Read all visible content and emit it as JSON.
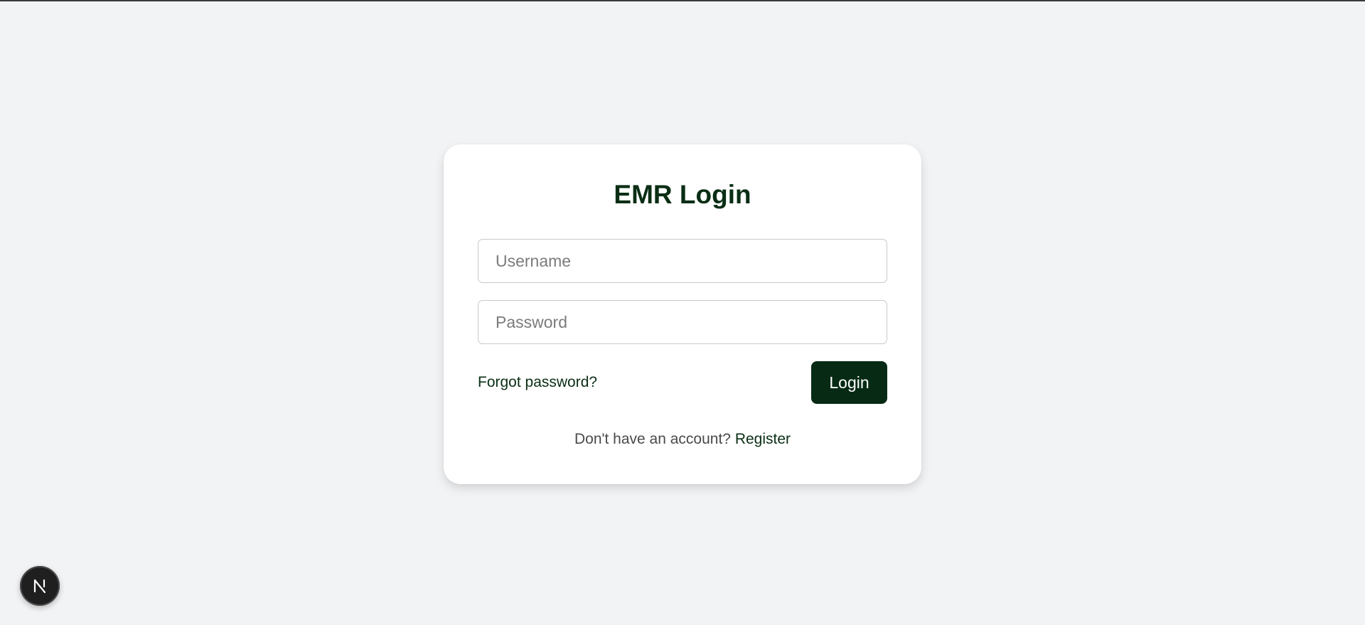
{
  "login_card": {
    "title": "EMR Login",
    "username_placeholder": "Username",
    "password_placeholder": "Password",
    "forgot_password_label": "Forgot password?",
    "login_button_label": "Login",
    "register_prompt": "Don't have an account?",
    "register_link_label": "Register"
  },
  "dev_badge": {
    "icon": "nextjs-logo-icon"
  },
  "colors": {
    "page_background": "#f2f3f5",
    "card_background": "#ffffff",
    "brand_dark_green": "#062a14",
    "heading_text": "#0a2e14",
    "muted_text": "#4a4a4a",
    "input_border": "#c9c9c9"
  }
}
